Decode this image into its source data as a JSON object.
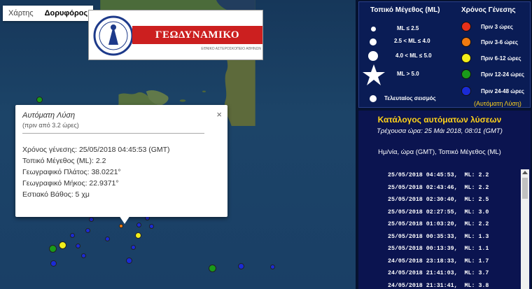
{
  "map": {
    "map_type_buttons": [
      "Χάρτης",
      "Δορυφόρος"
    ],
    "logo": {
      "title": "ΓΕΩΔΥΝΑΜΙΚΟ ΙΝΣΤΙΤΟΥΤΟ",
      "subtitle": "ΕΘΝΙΚΟ ΑΣΤΕΡΟΣΚΟΠΕΙΟ ΑΘΗΝΩΝ"
    },
    "popup": {
      "title": "Αυτόματη Λύση",
      "subtitle": "(πριν από 3.2 ώρες)",
      "close": "×",
      "lines": [
        "Χρόνος γένεσης: 25/05/2018  04:45:53 (GMT)",
        "Τοπικό Μέγεθος (ML): 2.2",
        "Γεωγραφικό Πλάτος: 38.0221°",
        "Γεωγραφικό Μήκος: 22.9371°",
        "Εστιακό Βάθος: 5 χμ"
      ]
    },
    "quake_colors": {
      "blue": "#1a2bd6",
      "green": "#1a9a1a",
      "yellow": "#f2ee1a",
      "orange": "#f07a10"
    }
  },
  "legend": {
    "magnitude_header": "Τοπικό Μέγεθος (ML)",
    "time_header": "Χρόνος Γένεσης",
    "magnitude_rows": [
      "ML ≤ 2.5",
      "2.5 < ML ≤ 4.0",
      "4.0 < ML ≤ 5.0",
      "ML > 5.0",
      "Τελευταίος σεισμός"
    ],
    "time_rows": [
      {
        "label": "Πριν 3 ώρες",
        "color": "#e8301a"
      },
      {
        "label": "Πριν 3-6 ώρες",
        "color": "#f07a10"
      },
      {
        "label": "Πριν 6-12 ώρες",
        "color": "#f2ee1a"
      },
      {
        "label": "Πριν 12-24 ώρες",
        "color": "#1a9a1a"
      },
      {
        "label": "Πριν 24-48 ώρες",
        "color": "#1a2bd6"
      }
    ],
    "auto_solution_link": "(Αυτόματη Λύση)"
  },
  "catalog": {
    "title": "Κατάλογος αυτόματων λύσεων",
    "current_time": "Τρέχουσα ώρα: 25 Μάι 2018, 08:01 (GMT)",
    "columns_label": "Ημ/νία, ώρα (GMT), Τοπικό Μέγεθος (ML)",
    "entries": [
      "25/05/2018 04:45:53,  ML: 2.2",
      "25/05/2018 02:43:46,  ML: 2.2",
      "25/05/2018 02:30:40,  ML: 2.5",
      "25/05/2018 02:27:55,  ML: 3.0",
      "25/05/2018 01:03:20,  ML: 2.2",
      "25/05/2018 00:35:33,  ML: 1.3",
      "25/05/2018 00:13:39,  ML: 1.1",
      "24/05/2018 23:18:33,  ML: 1.7",
      "24/05/2018 21:41:03,  ML: 3.7",
      "24/05/2018 21:31:41,  ML: 3.8"
    ]
  }
}
